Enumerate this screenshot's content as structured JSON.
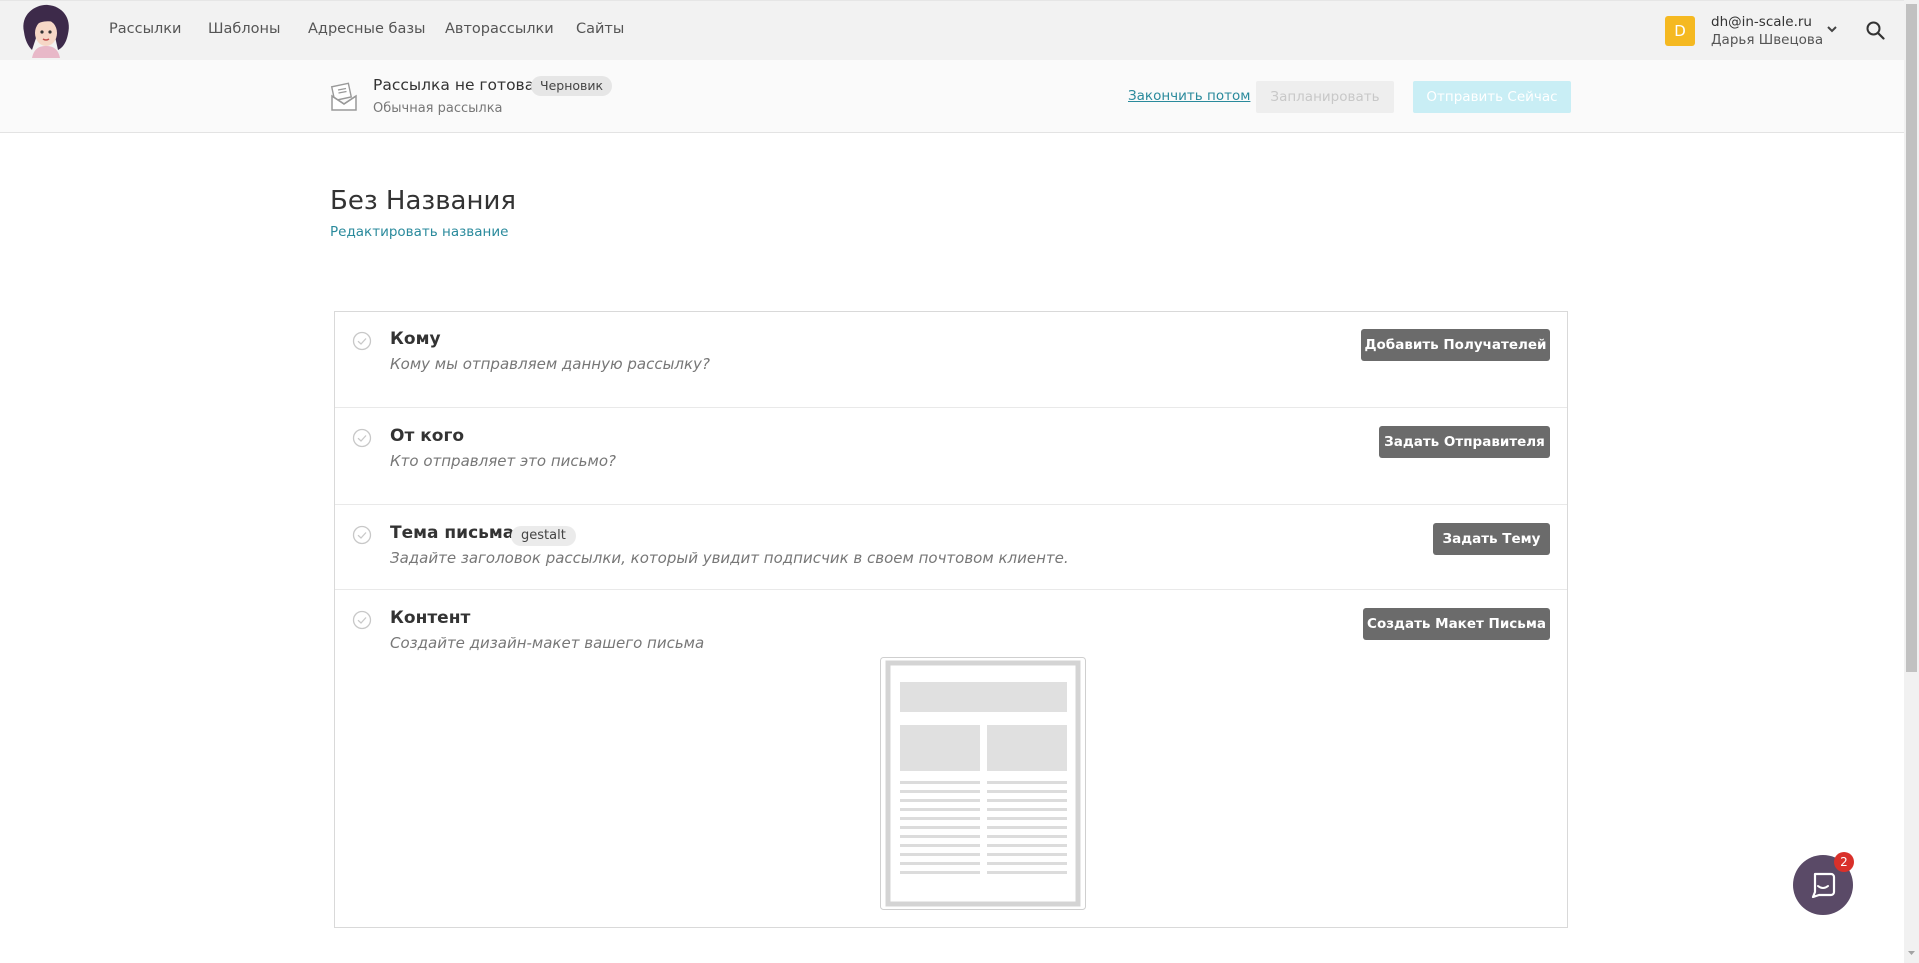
{
  "nav": {
    "items": [
      "Рассылки",
      "Шаблоны",
      "Адресные базы",
      "Авторассылки",
      "Сайты"
    ],
    "user": {
      "initial": "D",
      "email": "dh@in-scale.ru",
      "name": "Дарья Швецова"
    }
  },
  "subheader": {
    "status_title": "Рассылка не готова",
    "status_badge": "Черновик",
    "status_sub": "Обычная рассылка",
    "finish_later": "Закончить потом",
    "schedule": "Запланировать",
    "send_now": "Отправить Сейчас"
  },
  "campaign": {
    "title": "Без Названия",
    "edit_name": "Редактировать название"
  },
  "steps": [
    {
      "title": "Кому",
      "desc": "Кому мы отправляем данную рассылку?",
      "button": "Добавить Получателей"
    },
    {
      "title": "От кого",
      "desc": "Кто отправляет это письмо?",
      "button": "Задать Отправителя"
    },
    {
      "title": "Тема письма",
      "badge": "gestalt",
      "desc": "Задайте заголовок рассылки, который увидит подписчик в своем почтовом клиенте.",
      "button": "Задать Тему"
    },
    {
      "title": "Контент",
      "desc": "Создайте дизайн-макет вашего письма",
      "button": "Создать Макет Письма"
    }
  ],
  "chat": {
    "unread": "2"
  },
  "colors": {
    "accent_link": "#2a8a9c",
    "avatar": "#f5b921",
    "dark_button": "#6b6b6b",
    "send_button_disabled": "#c9eef5",
    "chat": "#5a4a67",
    "badge": "#d9302a"
  }
}
